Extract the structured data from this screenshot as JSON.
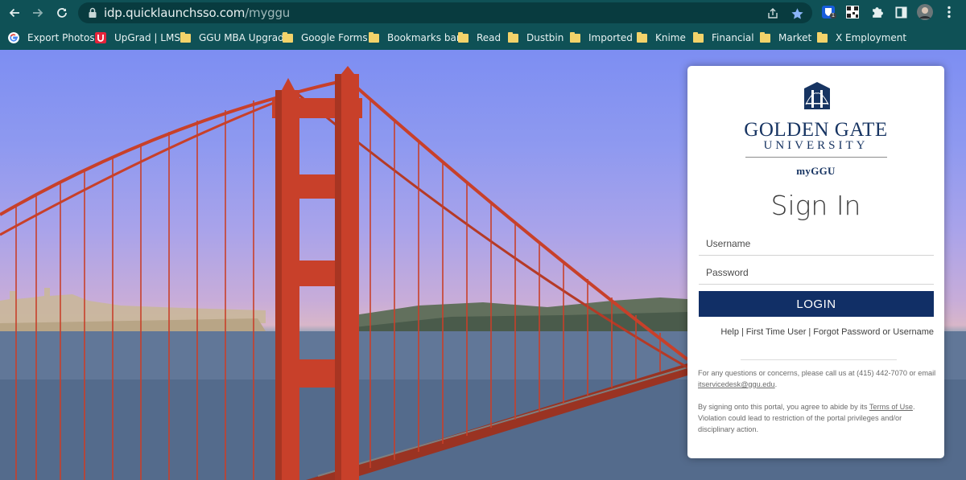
{
  "browser": {
    "url_host": "idp.quicklaunchsso.com",
    "url_path": "/myggu",
    "extension_badge": "1"
  },
  "bookmarks": [
    {
      "label": "Export Photos",
      "icon": "google-g-icon"
    },
    {
      "label": "UpGrad | LMS",
      "icon": "upgrad-icon"
    },
    {
      "label": "GGU MBA Upgrad",
      "icon": "folder-icon"
    },
    {
      "label": "Google Forms",
      "icon": "folder-icon"
    },
    {
      "label": "Bookmarks bar",
      "icon": "folder-icon"
    },
    {
      "label": "Read",
      "icon": "folder-icon"
    },
    {
      "label": "Dustbin",
      "icon": "folder-icon"
    },
    {
      "label": "Imported",
      "icon": "folder-icon"
    },
    {
      "label": "Knime",
      "icon": "folder-icon"
    },
    {
      "label": "Financial",
      "icon": "folder-icon"
    },
    {
      "label": "Market",
      "icon": "folder-icon"
    },
    {
      "label": "X Employment",
      "icon": "folder-icon"
    }
  ],
  "login": {
    "brand_line1": "GOLDEN GATE",
    "brand_line2": "UNIVERSITY",
    "brand_line3": "myGGU",
    "heading": "Sign In",
    "username_placeholder": "Username",
    "password_placeholder": "Password",
    "login_label": "LOGIN",
    "links": {
      "help": "Help",
      "first_time": "First Time User",
      "forgot": "Forgot Password or Username",
      "separator": "|"
    },
    "contact_text": "For any questions or concerns, please call us at (415) 442-7070 or email",
    "contact_email": "itservicedesk@ggu.edu",
    "contact_end": ".",
    "terms_before": "By signing onto this portal, you agree to abide by its",
    "terms_link": "Terms of Use",
    "terms_after": ". Violation could lead to restriction of the portal privileges and/or disciplinary action."
  },
  "colors": {
    "chrome": "#0f5156",
    "brand_navy": "#173462",
    "login_button": "#112f66",
    "bridge_red": "#c8402a"
  }
}
